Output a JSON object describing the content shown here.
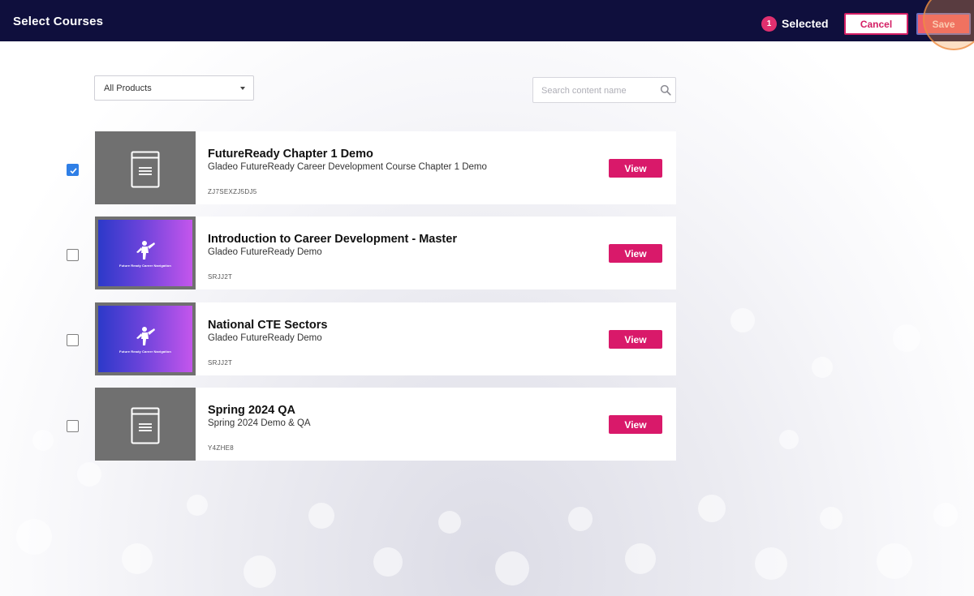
{
  "header": {
    "title": "Select Courses",
    "selected_count": "1",
    "selected_label": "Selected",
    "cancel_label": "Cancel",
    "save_label": "Save"
  },
  "filter": {
    "selected": "All Products"
  },
  "search": {
    "placeholder": "Search content name",
    "value": ""
  },
  "courses": [
    {
      "title": "FutureReady Chapter 1 Demo",
      "subtitle": "Gladeo FutureReady Career Development Course Chapter 1 Demo",
      "code": "ZJ7SEXZJ5DJ5",
      "checked": true,
      "thumbnail": "document-icon",
      "view_label": "View"
    },
    {
      "title": "Introduction to Career Development - Master",
      "subtitle": "Gladeo FutureReady Demo",
      "code": "SRJJ2T",
      "checked": false,
      "thumbnail": "cover-image",
      "thumb_text": "Future Ready Career Navigation",
      "view_label": "View"
    },
    {
      "title": "National CTE Sectors",
      "subtitle": "Gladeo FutureReady Demo",
      "code": "SRJJ2T",
      "checked": false,
      "thumbnail": "cover-image",
      "thumb_text": "Future Ready Career Navigation",
      "view_label": "View"
    },
    {
      "title": "Spring 2024 QA",
      "subtitle": "Spring 2024 Demo & QA",
      "code": "Y4ZHE8",
      "checked": false,
      "thumbnail": "document-icon",
      "view_label": "View"
    }
  ],
  "colors": {
    "header_bg": "#0f0f3d",
    "accent_pink": "#d9196a",
    "checkbox_checked": "#2f7fe6",
    "thumb_gray": "#707070"
  }
}
